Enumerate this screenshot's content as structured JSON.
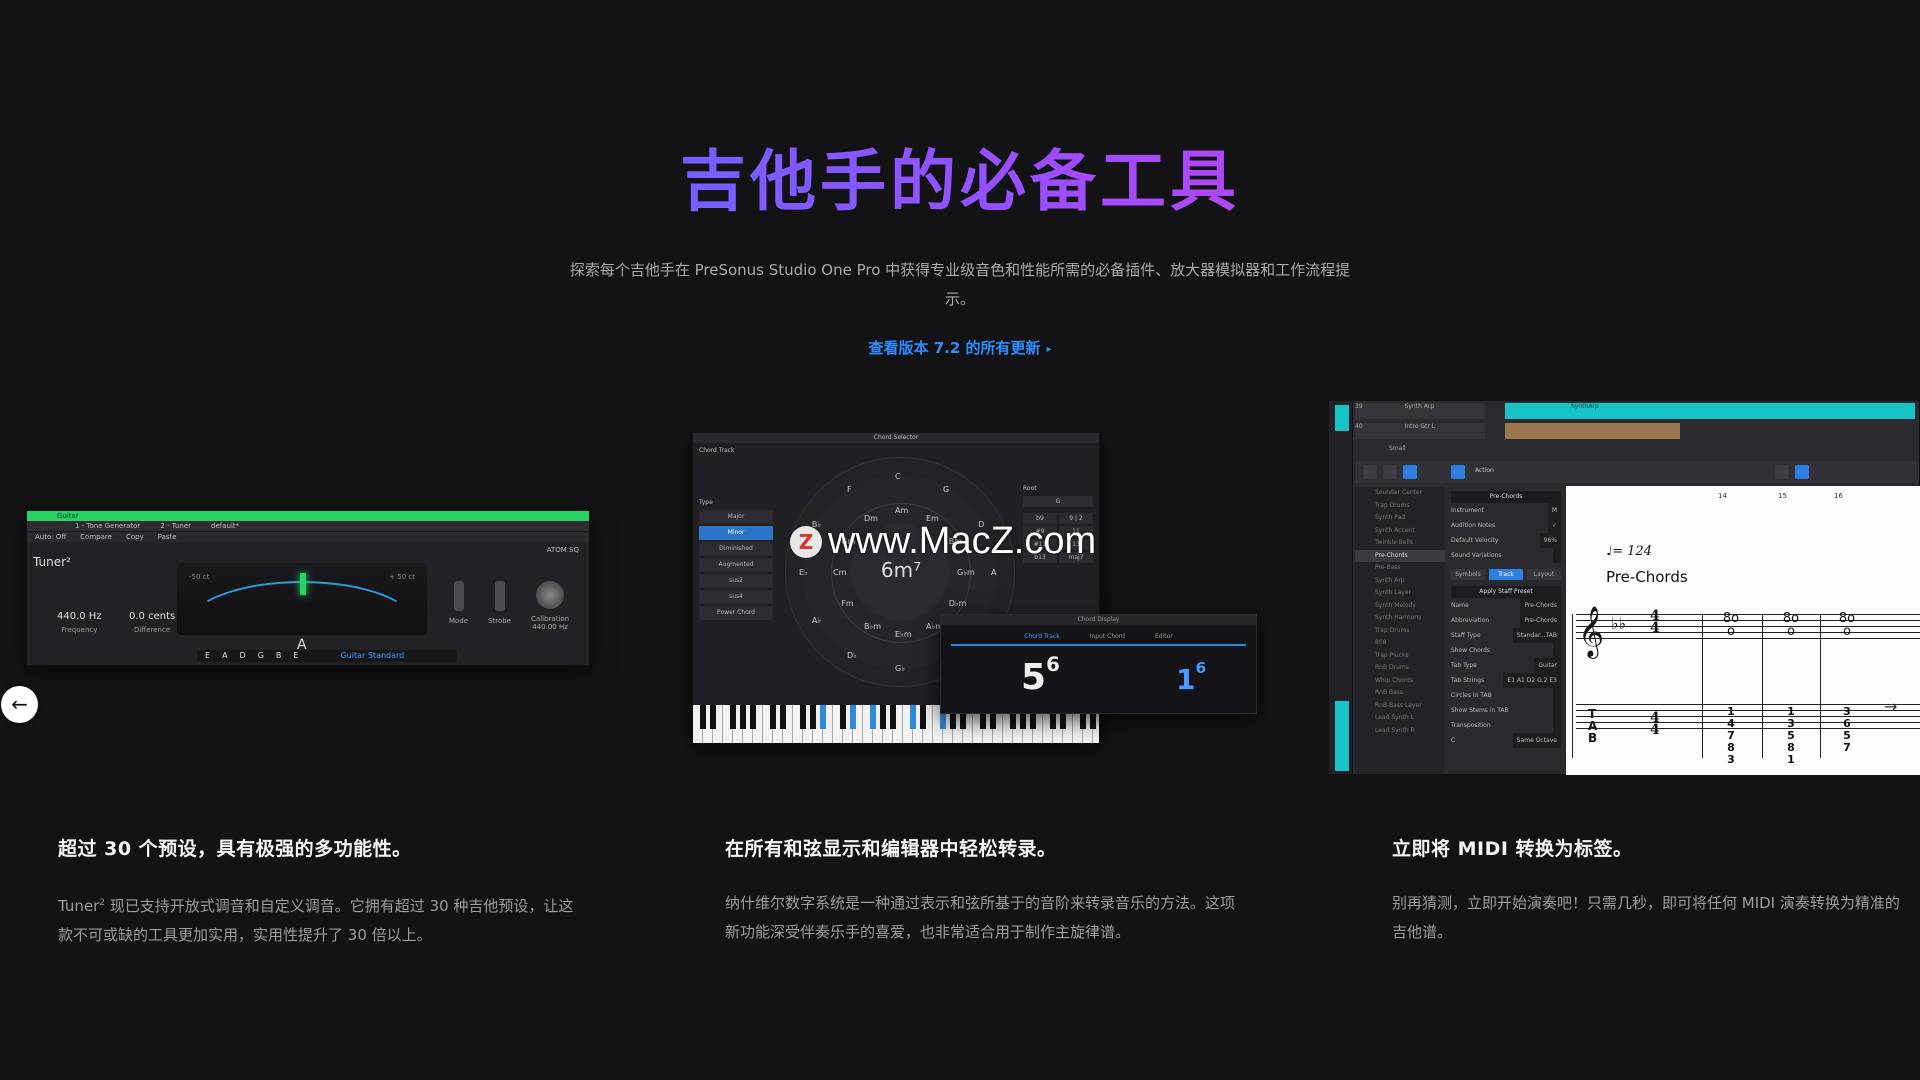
{
  "hero": {
    "title": "吉他手的必备工具",
    "description": "探索每个吉他手在 PreSonus Studio One Pro 中获得专业级音色和性能所需的必备插件、放大器模拟器和工作流程提示。",
    "link": "查看版本 7.2 的所有更新",
    "link_arrow": "▸"
  },
  "carousel": {
    "prev": "←",
    "next": "→"
  },
  "tuner": {
    "window_title": "Guitar",
    "tabs": [
      "1 - Tone Generator",
      "2 - Tuner"
    ],
    "toolbar": [
      "Auto: Off",
      "Compare",
      "Copy",
      "Paste"
    ],
    "preset": "default*",
    "name": "Tuner²",
    "device": "ATOM SQ",
    "frequency": "440.0 Hz",
    "frequency_label": "Frequency",
    "difference": "0.0 cents",
    "difference_label": "Difference",
    "scale_left": "-50 ct",
    "scale_right": "+ 50 ct",
    "note": "A",
    "strings": [
      "E",
      "A",
      "D",
      "G",
      "B",
      "E"
    ],
    "tuning_preset": "Guitar Standard",
    "mode_label": "Mode",
    "strobe_label": "Strobe",
    "calibration_label": "Calibration",
    "calibration_value": "440.00 Hz"
  },
  "chord_selector": {
    "title": "Chord Selector",
    "track": "Chord Track",
    "type_label": "Type",
    "types": [
      "Major",
      "Minor",
      "Diminished",
      "Augmented",
      "sus2",
      "sus4",
      "Power Chord"
    ],
    "selected_type": "Minor",
    "center_chord": "6m⁷",
    "wheel_outer": [
      "C",
      "G",
      "D",
      "A",
      "E",
      "B",
      "G♭",
      "D♭",
      "A♭",
      "E♭",
      "B♭",
      "F"
    ],
    "wheel_inner": [
      "Am",
      "Em",
      "Bm",
      "G♭m",
      "D♭m",
      "A♭m",
      "E♭m",
      "B♭m",
      "Fm",
      "Cm",
      "Gm",
      "Dm"
    ],
    "root_label": "Root",
    "root_value": "G",
    "root_grid": [
      "b9",
      "9 | 2",
      "#9",
      "11",
      "#11",
      "13",
      "b13",
      "maj7"
    ]
  },
  "chord_display": {
    "title": "Chord Display",
    "tabs": [
      "Chord Track",
      "Input Chord",
      "Editor"
    ],
    "value1": "5",
    "value1_sup": "6",
    "value2": "1",
    "value2_sup": "6"
  },
  "score_editor": {
    "tracks": [
      "Synth Arp",
      "Intro Gtr L"
    ],
    "track_numbers": [
      "39",
      "40"
    ],
    "clip_label": "SynthArp",
    "size_label": "Small",
    "action_label": "Action",
    "instruments": [
      "Sounder Center",
      "Trap Drums",
      "Synth Pad",
      "Synth Accent",
      "Twinkle Bells",
      "Pre-Chords",
      "Pre-Bass",
      "Synth Arp",
      "Synth Layer",
      "Synth Melody",
      "Synth Harmony",
      "Trap Drums",
      "808",
      "Trap Plucks",
      "RnB Drums",
      "Whip Chords",
      "RnB Bass",
      "RnB Bass Layer",
      "Lead Synth L",
      "Lead Synth R"
    ],
    "selected_instrument": "Pre-Chords",
    "props_header": "Pre-Chords",
    "props": [
      {
        "k": "Instrument",
        "v": "M"
      },
      {
        "k": "Audition Notes",
        "v": "✓"
      },
      {
        "k": "Default Velocity",
        "v": "96%"
      },
      {
        "k": "Sound Variations",
        "v": ""
      }
    ],
    "props_tabs": [
      "Symbols",
      "Track",
      "Layout"
    ],
    "apply_preset": "Apply Staff Preset",
    "props2": [
      {
        "k": "Name",
        "v": "Pre-Chords"
      },
      {
        "k": "Abbreviation",
        "v": "Pre-Chords"
      },
      {
        "k": "Staff Type",
        "v": "Standar...TAB"
      },
      {
        "k": "Show Chords",
        "v": ""
      },
      {
        "k": "Tab Type",
        "v": "Guitar"
      },
      {
        "k": "Tab Strings",
        "v": "E1 A1 D2 G.2 E3"
      },
      {
        "k": "Circles in TAB",
        "v": ""
      },
      {
        "k": "Show Stems in TAB",
        "v": ""
      },
      {
        "k": "Transposition",
        "v": ""
      }
    ],
    "transposition": [
      "C",
      "Same Octave"
    ],
    "measures": [
      "14",
      "15",
      "16"
    ],
    "tempo": "♩= 124",
    "sheet_title": "Pre-Chords",
    "clef": "𝄞",
    "key_sig": "♭♭",
    "time_sig_top": "4",
    "time_sig_bottom": "4",
    "tab_label": "T\nA\nB",
    "tab_cols": [
      [
        "1",
        "4",
        "7",
        "8",
        "3"
      ],
      [
        "1",
        "3",
        "5",
        "8",
        "1"
      ],
      [
        "3",
        "6",
        "5",
        "7",
        ""
      ]
    ]
  },
  "features": [
    {
      "title": "超过 30 个预设，具有极强的多功能性。",
      "body_name": "Tuner",
      "body_sup": "2",
      "body": " 现已支持开放式调音和自定义调音。它拥有超过 30 种吉他预设，让这款不可或缺的工具更加实用，实用性提升了 30 倍以上。"
    },
    {
      "title": "在所有和弦显示和编辑器中轻松转录。",
      "body": "纳什维尔数字系统是一种通过表示和弦所基于的音阶来转录音乐的方法。这项新功能深受伴奏乐手的喜爱，也非常适合用于制作主旋律谱。"
    },
    {
      "title": "立即将 MIDI 转换为标签。",
      "body": "别再猜测，立即开始演奏吧！只需几秒，即可将任何 MIDI 演奏转换为精准的吉他谱。"
    }
  ],
  "watermark": {
    "letter": "Z",
    "text": "www.MacZ.com"
  },
  "colors": {
    "background": "#131315",
    "accent_blue": "#2d8cff",
    "tuner_green": "#25d366",
    "cyan": "#17c3c7"
  }
}
